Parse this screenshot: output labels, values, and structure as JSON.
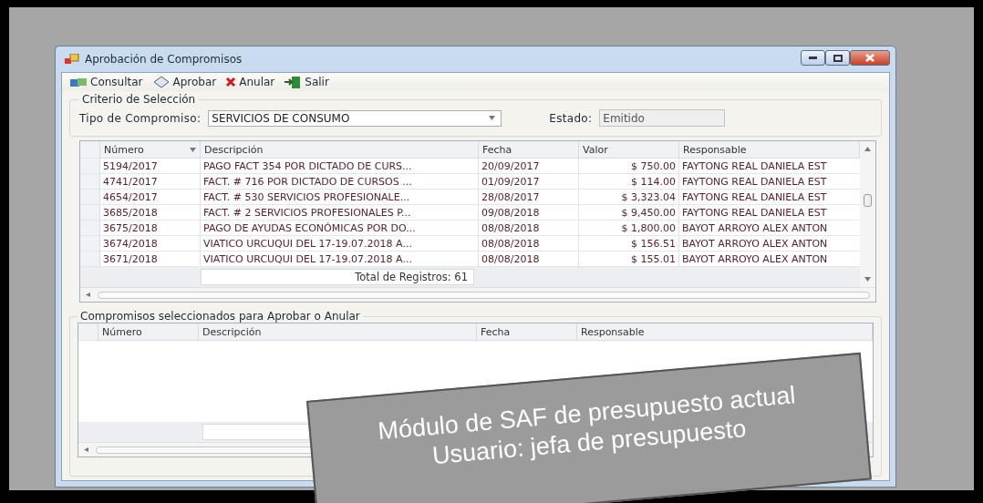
{
  "window": {
    "title": "Aprobación de Compromisos"
  },
  "toolbar": [
    {
      "kind": "consult",
      "label": "Consultar"
    },
    {
      "kind": "approve",
      "label": "Aprobar"
    },
    {
      "kind": "cancel",
      "label": "Anular"
    },
    {
      "kind": "exit",
      "label": "Salir"
    }
  ],
  "criteria": {
    "title": "Criterio de Selección",
    "type_label": "Tipo de Compromiso:",
    "type_value": "SERVICIOS DE CONSUMO",
    "state_label": "Estado:",
    "state_value": "Emitido"
  },
  "table": {
    "columns": [
      "Número",
      "Descripción",
      "Fecha",
      "Valor",
      "Responsable"
    ],
    "rows": [
      [
        "5194/2017",
        "PAGO FACT 354 POR DICTADO DE CURS...",
        "20/09/2017",
        "$ 750.00",
        "FAYTONG REAL DANIELA  EST"
      ],
      [
        "4741/2017",
        "FACT. # 716 POR DICTADO DE CURSOS ...",
        "01/09/2017",
        "$ 114.00",
        "FAYTONG REAL DANIELA  EST"
      ],
      [
        "4654/2017",
        "FACT. # 530 SERVICIOS PROFESIONALE...",
        "28/08/2017",
        "$ 3,323.04",
        "FAYTONG REAL DANIELA  EST"
      ],
      [
        "3685/2018",
        "FACT. # 2 SERVICIOS PROFESIONALES P...",
        "09/08/2018",
        "$ 9,450.00",
        "FAYTONG REAL DANIELA  EST"
      ],
      [
        "3675/2018",
        "PAGO DE AYUDAS ECONÓMICAS POR DO...",
        "08/08/2018",
        "$ 1,800.00",
        "BAYOT ARROYO ALEX ANTON"
      ],
      [
        "3674/2018",
        "VIATICO URCUQUI DEL  17-19.07.2018 A...",
        "08/08/2018",
        "$ 156.51",
        "BAYOT ARROYO ALEX ANTON"
      ],
      [
        "3671/2018",
        "VIATICO URCUQUI DEL  17-19.07.2018 A...",
        "08/08/2018",
        "$ 155.01",
        "BAYOT ARROYO ALEX ANTON"
      ]
    ],
    "total": "Total de Registros: 61"
  },
  "selected": {
    "title": "Compromisos seleccionados para Aprobar o Anular",
    "columns": [
      "Número",
      "Descripción",
      "Fecha",
      "Responsable"
    ]
  },
  "banner": {
    "lines": [
      "Módulo de SAF de presupuesto actual",
      "Usuario: jefa de presupuesto"
    ]
  }
}
